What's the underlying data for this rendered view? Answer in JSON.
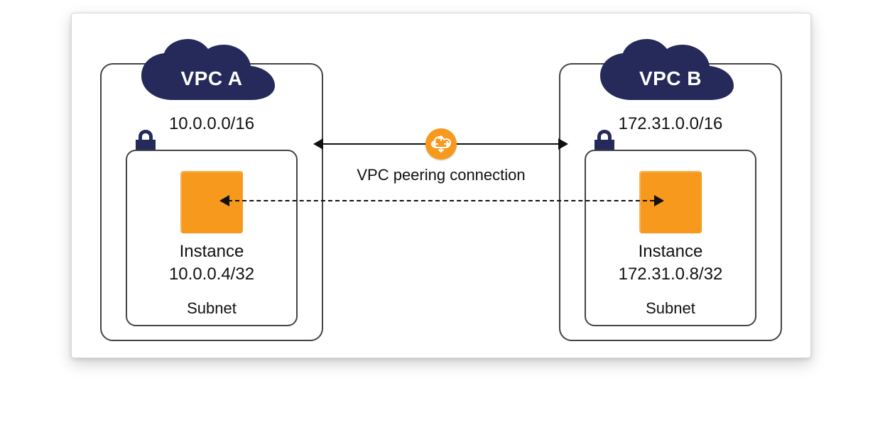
{
  "peering_label": "VPC peering connection",
  "vpc_a": {
    "name": "VPC A",
    "cidr": "10.0.0.0/16",
    "subnet_label": "Subnet",
    "instance_label": "Instance",
    "instance_ip": "10.0.0.4/32"
  },
  "vpc_b": {
    "name": "VPC B",
    "cidr": "172.31.0.0/16",
    "subnet_label": "Subnet",
    "instance_label": "Instance",
    "instance_ip": "172.31.0.8/32"
  },
  "colors": {
    "cloud": "#262a5a",
    "instance": "#f7991c",
    "peer_icon": "#f7991c"
  }
}
